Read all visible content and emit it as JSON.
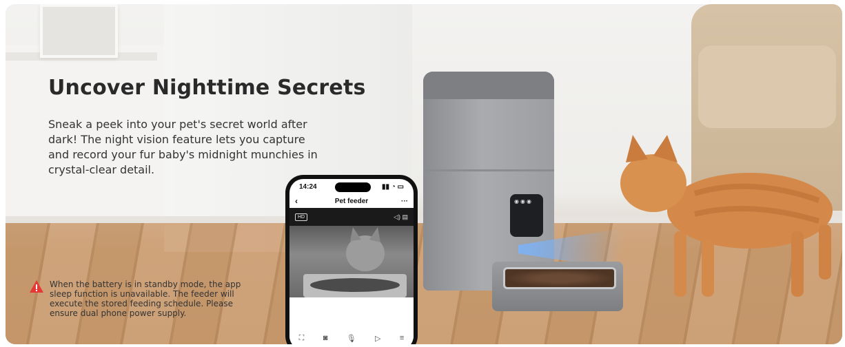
{
  "hero": {
    "headline": "Uncover Nighttime Secrets",
    "body": "Sneak a peek into your pet's secret world after dark! The night vision feature lets you capture and record your fur baby's midnight munchies in crystal-clear detail."
  },
  "notice": {
    "icon": "warning-icon",
    "icon_color": "#e53935",
    "text": "When the battery is in standby mode, the app sleep function is unavailable. The feeder will execute the stored feeding schedule. Please ensure dual phone power supply."
  },
  "phone": {
    "status_time": "14:24",
    "app_title": "Pet feeder",
    "back_icon": "chevron-left-icon",
    "more_icon": "more-icon",
    "quality_badge": "HD",
    "toolbar_icons": [
      "fullscreen-icon",
      "screenshot-icon",
      "microphone-icon",
      "record-icon",
      "menu-icon"
    ]
  }
}
